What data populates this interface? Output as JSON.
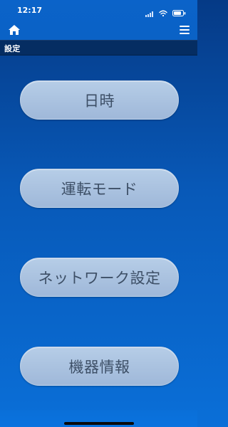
{
  "status_bar": {
    "time": "12:17"
  },
  "header": {
    "home_icon": "home-icon",
    "menu_icon": "menu-icon",
    "section_title": "設定"
  },
  "menu": {
    "items": [
      {
        "label": "日時"
      },
      {
        "label": "運転モード"
      },
      {
        "label": "ネットワーク設定"
      },
      {
        "label": "機器情報"
      }
    ]
  },
  "colors": {
    "background_top": "#053a86",
    "background_bottom": "#0a6fd8",
    "button_fill": "#afc6e4",
    "button_text": "#3d4f66",
    "section_bar": "#052d62"
  }
}
